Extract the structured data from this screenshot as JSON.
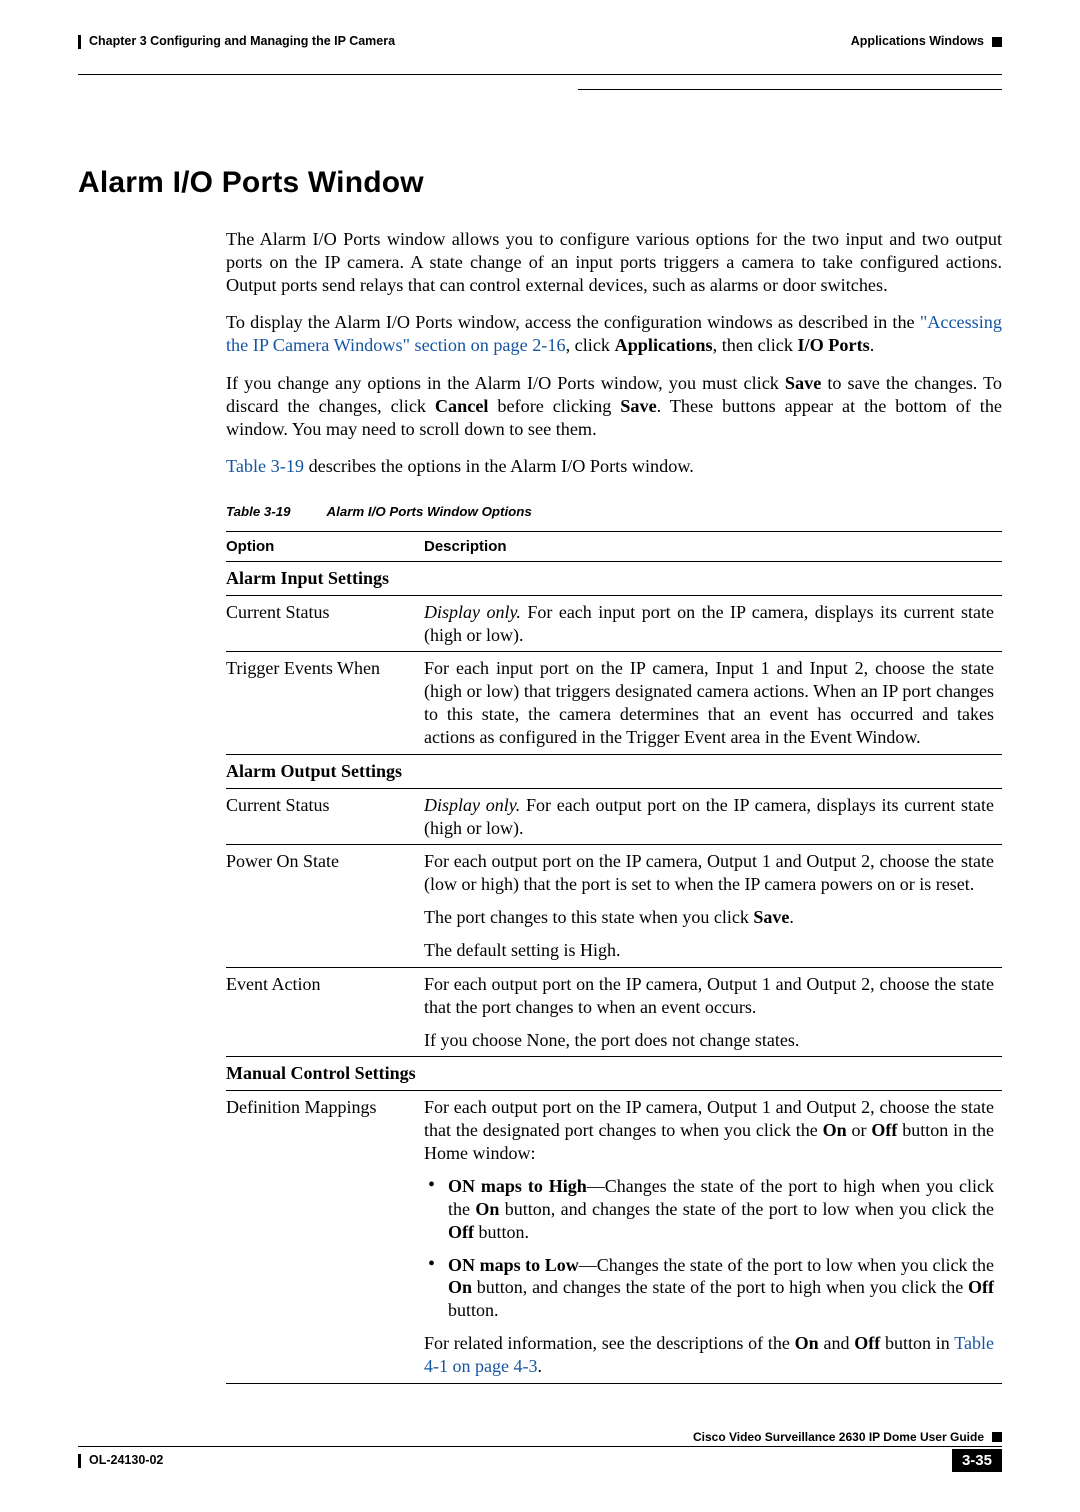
{
  "header": {
    "chapter": "Chapter 3      Configuring and Managing the IP Camera",
    "section": "Applications Windows"
  },
  "title": "Alarm I/O Ports Window",
  "paragraphs": {
    "p1": "The Alarm I/O Ports window allows you to configure various options for the two input and two output ports on the IP camera. A state change of an input ports triggers a camera to take configured actions. Output ports send relays that can control external devices, such as alarms or door switches.",
    "p2a": "To display the Alarm I/O Ports window, access the configuration windows as described in the ",
    "p2link": "\"Accessing the IP Camera Windows\" section on page 2-16",
    "p2b": ", click ",
    "p2_bold1": "Applications",
    "p2c": ", then click ",
    "p2_bold2": "I/O Ports",
    "p2d": ".",
    "p3a": "If you change any options in the Alarm I/O Ports window, you must click ",
    "p3_bold1": "Save",
    "p3b": " to save the changes. To discard the changes, click ",
    "p3_bold2": "Cancel",
    "p3c": " before clicking ",
    "p3_bold3": "Save",
    "p3d": ". These buttons appear at the bottom of the window. You may need to scroll down to see them.",
    "p4link": "Table 3-19",
    "p4rest": " describes the options in the Alarm I/O Ports window."
  },
  "table_caption": {
    "num": "Table 3-19",
    "title": "Alarm I/O Ports Window Options"
  },
  "table": {
    "headers": {
      "option": "Option",
      "description": "Description"
    },
    "sections": {
      "s1": "Alarm Input Settings",
      "s2": "Alarm Output Settings",
      "s3": "Manual Control Settings"
    },
    "rows": {
      "r1": {
        "opt": "Current Status",
        "italic": "Display only.",
        "rest": " For each input port on the IP camera, displays its current state (high or low)."
      },
      "r2": {
        "opt": "Trigger Events When",
        "desc": "For each input port on the IP camera, Input 1 and Input 2, choose the state (high or low) that triggers designated camera actions. When an IP port changes to this state, the camera determines that an event has occurred and takes actions as configured in the Trigger Event area in the Event Window."
      },
      "r3": {
        "opt": "Current Status",
        "italic": "Display only.",
        "rest": " For each output port on the IP camera, displays its current state (high or low)."
      },
      "r4": {
        "opt": "Power On State",
        "p1": "For each output port on the IP camera, Output 1 and Output 2, choose the state (low or high) that the port is set to when the IP camera powers on or is reset.",
        "p2a": "The port changes to this state when you click ",
        "p2_bold": "Save",
        "p2b": ".",
        "p3": "The default setting is High."
      },
      "r5": {
        "opt": "Event Action",
        "p1": "For each output port on the IP camera, Output 1 and Output 2, choose the state that the port changes to when an event occurs.",
        "p2": "If you choose None, the port does not change states."
      },
      "r6": {
        "opt": "Definition Mappings",
        "intro_a": "For each output port on the IP camera, Output 1 and Output 2, choose the state that the designated port changes to when you click the ",
        "intro_on": "On",
        "intro_mid": " or ",
        "intro_off": "Off",
        "intro_b": " button in the Home window:",
        "b1_bold": "ON maps to High",
        "b1_rest_a": "—Changes the state of the port to high when you click the ",
        "b1_on": "On",
        "b1_rest_b": " button, and changes the state of the port to low when you click the ",
        "b1_off": "Off",
        "b1_rest_c": " button.",
        "b2_bold": "ON maps to Low",
        "b2_rest_a": "—Changes the state of the port to low when you click the ",
        "b2_on": "On",
        "b2_rest_b": " button, and changes the state of the port to high when you click the ",
        "b2_off": "Off",
        "b2_rest_c": " button.",
        "out_a": "For related information, see the descriptions of the ",
        "out_on": "On",
        "out_mid": " and ",
        "out_off": "Off",
        "out_b": " button in ",
        "out_link": "Table 4-1 on page 4-3",
        "out_c": "."
      }
    }
  },
  "footer": {
    "doc_title": "Cisco Video Surveillance 2630 IP Dome User Guide",
    "doc_id": "OL-24130-02",
    "page": "3-35"
  }
}
